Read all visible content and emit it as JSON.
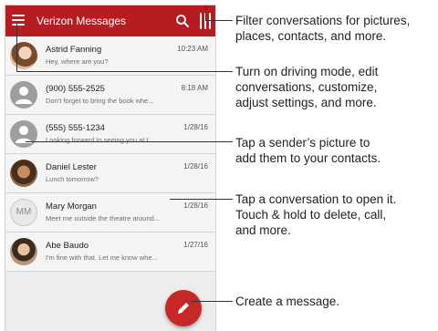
{
  "app": {
    "title": "Verizon Messages"
  },
  "conversations": [
    {
      "name": "Astrid Fanning",
      "snippet": "Hey, where are you?",
      "time": "10:23 AM",
      "avatar": "photo"
    },
    {
      "name": "(900) 555-2525",
      "snippet": "Don't forget to bring the book whe...",
      "time": "8:18 AM",
      "avatar": "generic-person"
    },
    {
      "name": "(555) 555-1234",
      "snippet": "Looking forward to seeing you at t...",
      "time": "1/28/16",
      "avatar": "generic-person"
    },
    {
      "name": "Daniel Lester",
      "snippet": "Lunch tomorrow?",
      "time": "1/28/16",
      "avatar": "photo"
    },
    {
      "name": "Mary Morgan",
      "snippet": "Meet me outside the theatre around...",
      "time": "1/28/16",
      "avatar": "initials",
      "initials": "MM"
    },
    {
      "name": "Abe Baudo",
      "snippet": "I'm fine with that. Let me know whe...",
      "time": "1/27/16",
      "avatar": "photo"
    }
  ],
  "callouts": {
    "filter": [
      "Filter conversations for pictures,",
      "places, contacts, and more."
    ],
    "menu": [
      "Turn on driving mode, edit",
      "conversations, customize,",
      "adjust settings, and more."
    ],
    "picture": [
      "Tap a sender’s picture to",
      "add them to your contacts."
    ],
    "conversation": [
      "Tap  a conversation to open it.",
      "Touch & hold to delete, call,",
      "and more."
    ],
    "compose": [
      "Create a message."
    ]
  },
  "colors": {
    "appbar": "#b81c23",
    "fab": "#c62828"
  },
  "icons": {
    "menu": "hamburger-menu-icon",
    "search": "search-icon",
    "filter": "filter-icon",
    "compose": "pencil-icon",
    "person": "person-icon"
  }
}
